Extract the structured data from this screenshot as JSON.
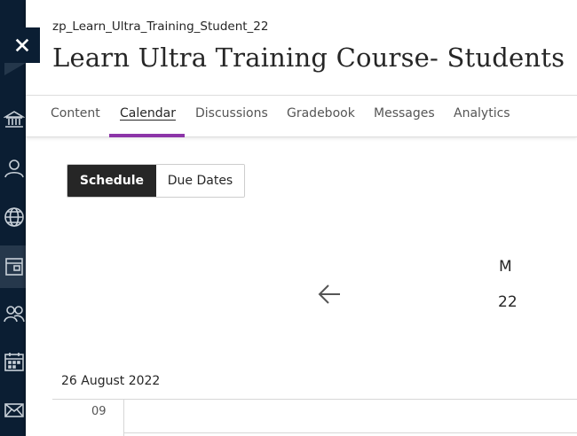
{
  "course": {
    "id": "zp_Learn_Ultra_Training_Student_22",
    "title": "Learn Ultra Training Course- Students"
  },
  "close": {
    "icon": "close-icon"
  },
  "rail": {
    "icons": [
      "institution-icon",
      "user-icon",
      "globe-icon",
      "courses-icon",
      "groups-icon",
      "calendar-icon",
      "messages-icon"
    ],
    "active": "courses-icon",
    "background": "#0b1e33"
  },
  "tabs": [
    {
      "label": "Content"
    },
    {
      "label": "Calendar",
      "active": true
    },
    {
      "label": "Discussions"
    },
    {
      "label": "Gradebook"
    },
    {
      "label": "Messages"
    },
    {
      "label": "Analytics"
    }
  ],
  "accent_color": "#8c35a8",
  "view_toggle": {
    "schedule": "Schedule",
    "due_dates": "Due Dates",
    "selected": "Schedule"
  },
  "calendar": {
    "day_letter": "M",
    "day_number": "22",
    "date": "26 August 2022",
    "first_hour": "09"
  }
}
